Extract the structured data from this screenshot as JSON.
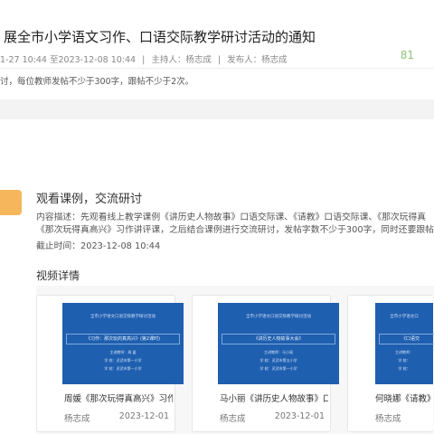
{
  "notice": {
    "title": "展全市小学语文习作、口语交际教学研讨活动的通知",
    "time_range": "1-27 10:44   至2023-12-08 10:44",
    "host": "主持人：杨志成",
    "publisher": "发布人：杨志成",
    "views": "81",
    "description": "讨，每位教师发帖不少于300字，跟帖不少于2次。"
  },
  "activity": {
    "title": "观看课例，交流研讨",
    "content_line1": "内容描述：先观看线上教学课例《讲历史人物故事》口语交际课、《请教》口语交际课、《那次玩得真",
    "content_line2": "《那次玩得真高兴》习作讲评课，之后结合课例进行交流研讨，发帖字数不少于300字，同时还要跟帖",
    "deadline": "截止时间：2023-12-08 10:44"
  },
  "video_section": {
    "title": "视频详情",
    "cards": [
      {
        "thumb_header": "全市小学语文口语交际教学研讨活动",
        "thumb_topic": "《习作：那次玩的真高兴》(第2课时)",
        "thumb_teacher": "主讲教师：周 媛",
        "thumb_school1": "学    校：灵武市第一小学",
        "thumb_school2": "学    校：灵武市第一小学",
        "title": "周媛《那次玩得真高兴》习作课...",
        "author": "杨志成",
        "date": "2023-12-01"
      },
      {
        "thumb_header": "全市小学语文口语交际教学研讨活动",
        "thumb_topic": "《讲历史人物故事大会》",
        "thumb_teacher": "主讲教师：马小丽",
        "thumb_school1": "学    校：灵武市第五小学",
        "thumb_school2": "学    校：灵武市第一小学",
        "title": "马小丽《讲历史人物故事》口语...",
        "author": "杨志成",
        "date": "2023-12-01"
      },
      {
        "thumb_header": "全市小学语文口",
        "thumb_topic": "《口语交",
        "thumb_teacher": "主讲教师：",
        "thumb_school1": "学    校：",
        "thumb_school2": "学    校：",
        "title": "何晓娜《请教》听",
        "author": "杨志成",
        "date": ""
      }
    ]
  }
}
